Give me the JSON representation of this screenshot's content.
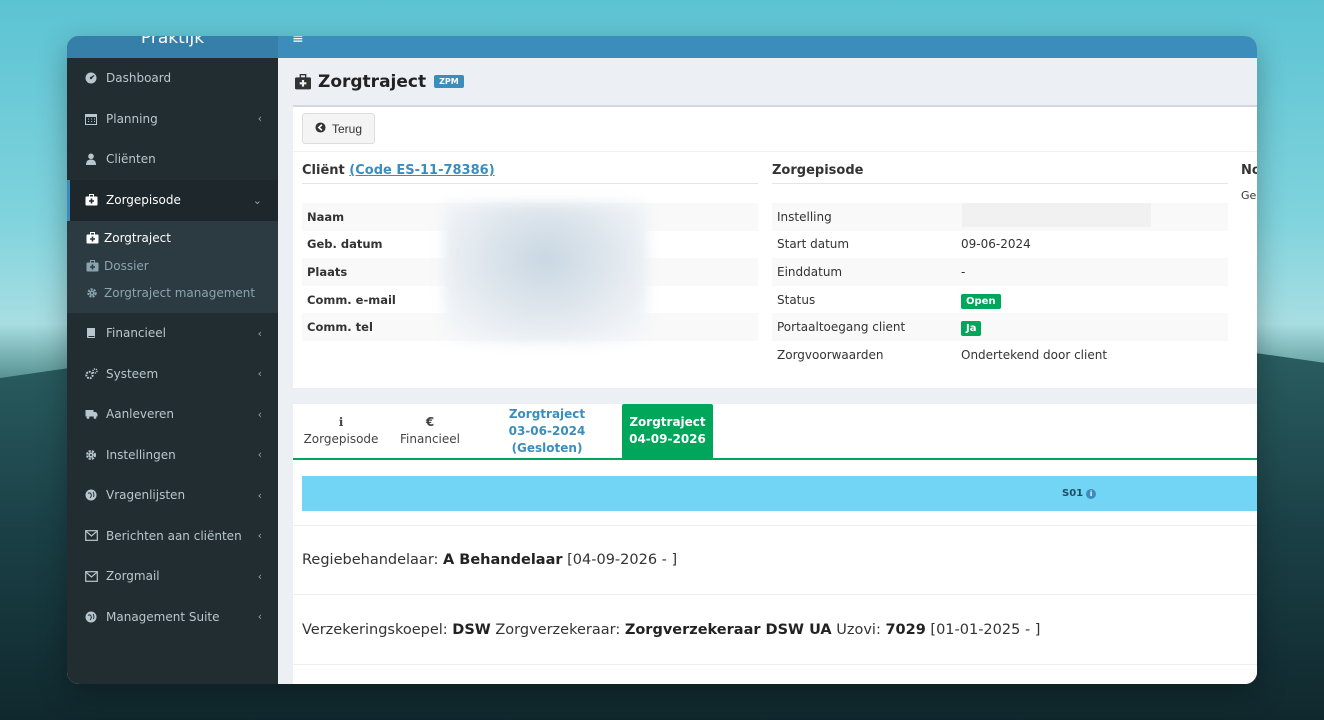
{
  "sidebar": {
    "logo": "Praktijk",
    "items": [
      {
        "label": "Dashboard",
        "chev": ""
      },
      {
        "label": "Planning",
        "chev": "‹"
      },
      {
        "label": "Cliënten",
        "chev": ""
      },
      {
        "label": "Zorgepisode",
        "chev": "⌄"
      },
      {
        "label": "Financieel",
        "chev": "‹"
      },
      {
        "label": "Systeem",
        "chev": "‹"
      },
      {
        "label": "Aanleveren",
        "chev": "‹"
      },
      {
        "label": "Instellingen",
        "chev": "‹"
      },
      {
        "label": "Vragenlijsten",
        "chev": "‹"
      },
      {
        "label": "Berichten aan cliënten",
        "chev": "‹"
      },
      {
        "label": "Zorgmail",
        "chev": "‹"
      },
      {
        "label": "Management Suite",
        "chev": "‹"
      }
    ],
    "submenu": [
      {
        "label": "Zorgtraject"
      },
      {
        "label": "Dossier"
      },
      {
        "label": "Zorgtraject management"
      }
    ]
  },
  "topbar": {
    "menu_glyph": "≡"
  },
  "page": {
    "title": "Zorgtraject",
    "badge": "ZPM"
  },
  "toolbar": {
    "back_label": "Terug"
  },
  "client": {
    "title_prefix": "Cliënt",
    "code_link": "(Code ES-11-78386)",
    "rows": [
      {
        "key": "Naam"
      },
      {
        "key": "Geb. datum"
      },
      {
        "key": "Plaats"
      },
      {
        "key": "Comm. e-mail"
      },
      {
        "key": "Comm. tel"
      }
    ]
  },
  "episode": {
    "title": "Zorgepisode",
    "rows": [
      {
        "key": "Instelling",
        "value": ""
      },
      {
        "key": "Start datum",
        "value": "09-06-2024"
      },
      {
        "key": "Einddatum",
        "value": "-"
      },
      {
        "key": "Status",
        "value": "Open"
      },
      {
        "key": "Portaaltoegang client",
        "value": "Ja"
      },
      {
        "key": "Zorgvoorwaarden",
        "value": "Ondertekend door client"
      }
    ]
  },
  "third_col": {
    "title": "No",
    "sub": "Ge"
  },
  "tabs": [
    {
      "icon": "ℹ",
      "label": "Zorgepisode"
    },
    {
      "icon": "€",
      "label": "Financieel"
    },
    {
      "line1": "Zorgtraject",
      "line2": "03-06-2024 (Gesloten)"
    },
    {
      "line1": "Zorgtraject",
      "line2": "04-09-2026"
    }
  ],
  "segment": {
    "label": "S01"
  },
  "regie": {
    "prefix": "Regiebehandelaar:",
    "name": "A Behandelaar",
    "period": "[04-09-2026 - ]"
  },
  "insurance": {
    "koepel_label": "Verzekeringskoepel:",
    "koepel": "DSW",
    "verz_label": "Zorgverzekeraar:",
    "verz": "Zorgverzekeraar DSW UA",
    "uzovi_label": "Uzovi:",
    "uzovi": "7029",
    "period": "[01-01-2025 - ]"
  }
}
